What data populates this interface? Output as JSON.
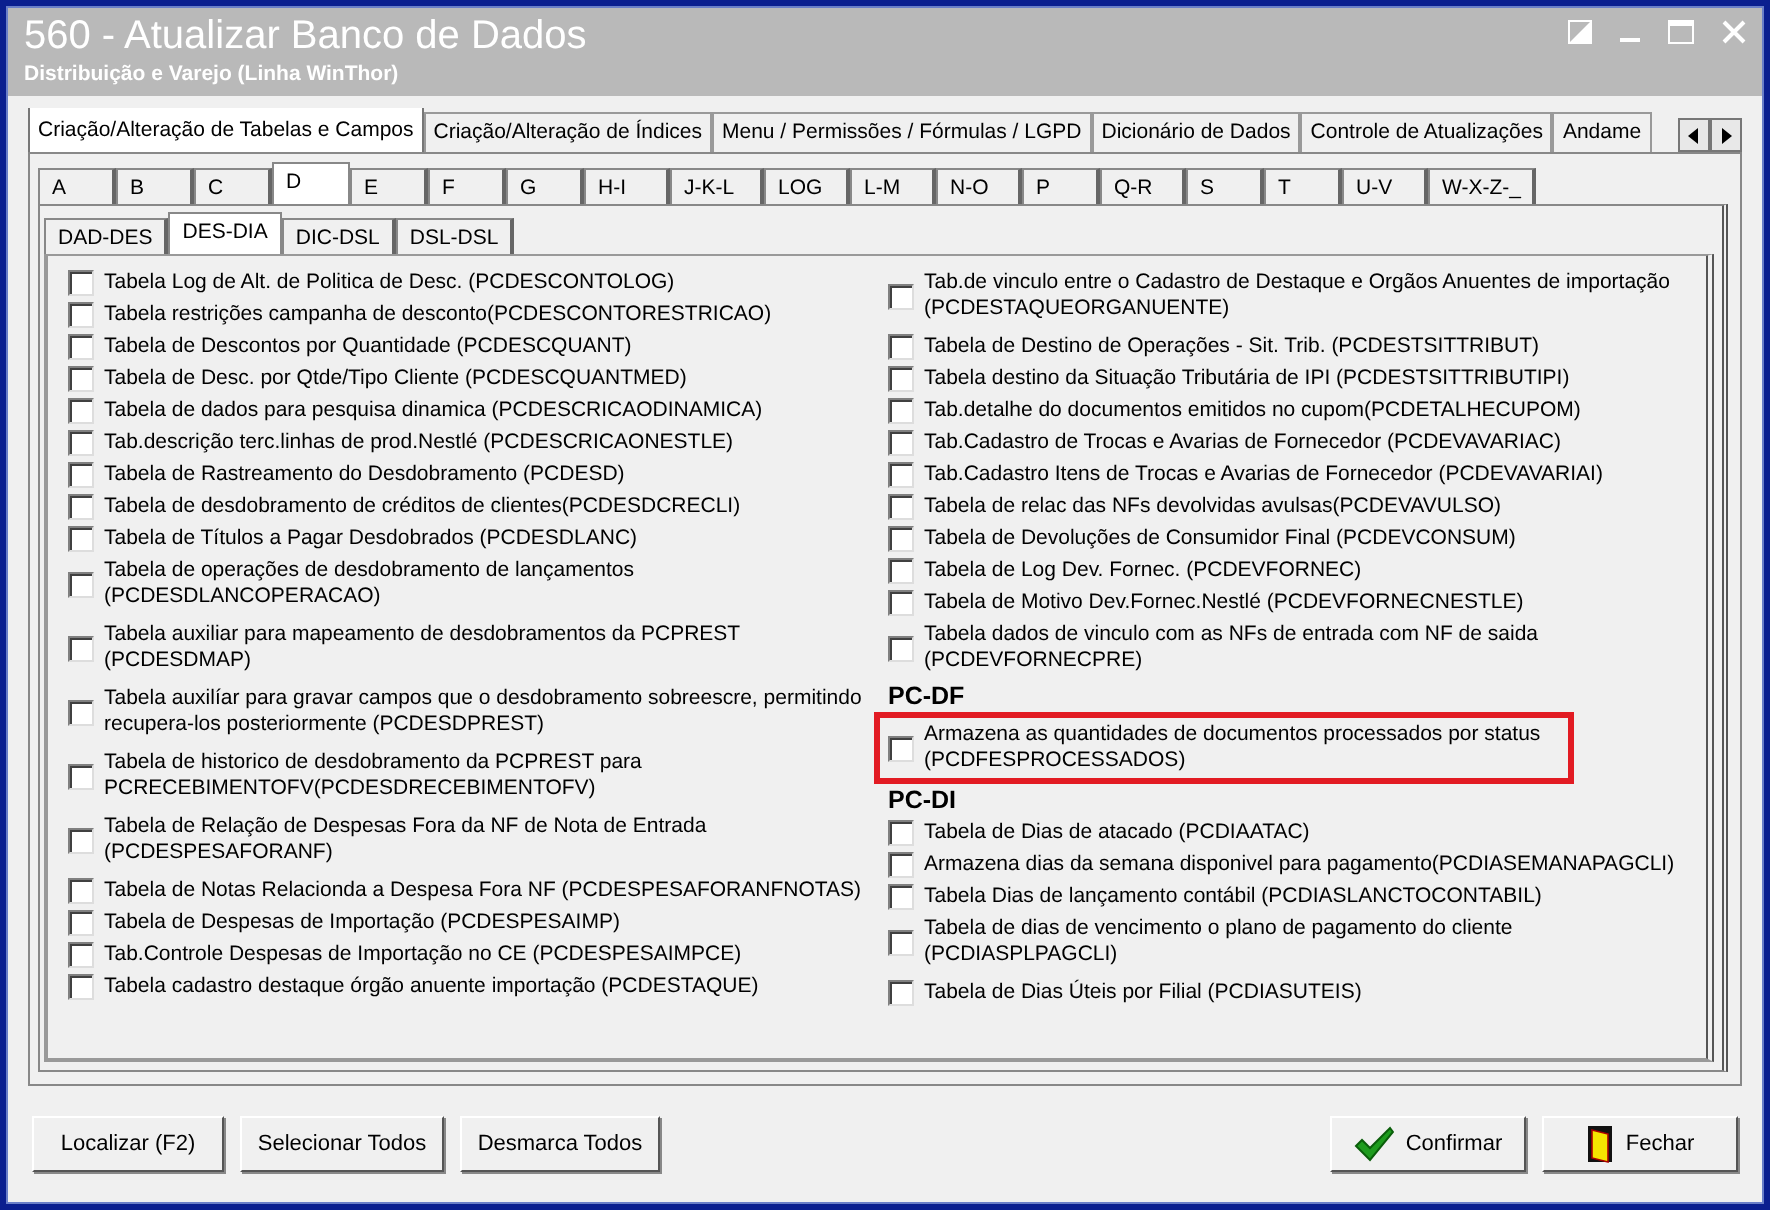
{
  "window": {
    "title": "560 - Atualizar Banco de Dados",
    "subtitle": "Distribuição e Varejo (Linha WinThor)"
  },
  "main_tabs": [
    {
      "label": "Criação/Alteração de Tabelas e Campos",
      "selected": true
    },
    {
      "label": "Criação/Alteração de Índices",
      "selected": false
    },
    {
      "label": "Menu / Permissões / Fórmulas / LGPD",
      "selected": false
    },
    {
      "label": "Dicionário de Dados",
      "selected": false
    },
    {
      "label": "Controle de Atualizações",
      "selected": false
    },
    {
      "label": "Andame",
      "selected": false
    }
  ],
  "letter_tabs": [
    {
      "label": "A",
      "selected": false
    },
    {
      "label": "B",
      "selected": false
    },
    {
      "label": "C",
      "selected": false
    },
    {
      "label": "D",
      "selected": true
    },
    {
      "label": "E",
      "selected": false
    },
    {
      "label": "F",
      "selected": false
    },
    {
      "label": "G",
      "selected": false
    },
    {
      "label": "H-I",
      "selected": false
    },
    {
      "label": "J-K-L",
      "selected": false
    },
    {
      "label": "LOG",
      "selected": false
    },
    {
      "label": "L-M",
      "selected": false
    },
    {
      "label": "N-O",
      "selected": false
    },
    {
      "label": "P",
      "selected": false
    },
    {
      "label": "Q-R",
      "selected": false
    },
    {
      "label": "S",
      "selected": false
    },
    {
      "label": "T",
      "selected": false
    },
    {
      "label": "U-V",
      "selected": false
    },
    {
      "label": "W-X-Z-_",
      "selected": false
    }
  ],
  "sub_tabs": [
    {
      "label": "DAD-DES",
      "selected": false
    },
    {
      "label": "DES-DIA",
      "selected": true
    },
    {
      "label": "DIC-DSL",
      "selected": false
    },
    {
      "label": "DSL-DSL",
      "selected": false
    }
  ],
  "left_items": [
    {
      "kind": "checkbox",
      "label": "Tabela Log de Alt. de Politica de Desc. (PCDESCONTOLOG)",
      "checked": false
    },
    {
      "kind": "checkbox",
      "label": "Tabela restrições campanha de desconto(PCDESCONTORESTRICAO)",
      "checked": false
    },
    {
      "kind": "checkbox",
      "label": "Tabela de Descontos por Quantidade (PCDESCQUANT)",
      "checked": false
    },
    {
      "kind": "checkbox",
      "label": "Tabela de Desc. por Qtde/Tipo Cliente (PCDESCQUANTMED)",
      "checked": false
    },
    {
      "kind": "checkbox",
      "label": "Tabela de dados para pesquisa dinamica (PCDESCRICAODINAMICA)",
      "checked": false
    },
    {
      "kind": "checkbox",
      "label": "Tab.descrição terc.linhas de prod.Nestlé (PCDESCRICAONESTLE)",
      "checked": false
    },
    {
      "kind": "checkbox",
      "label": "Tabela de Rastreamento do Desdobramento (PCDESD)",
      "checked": false
    },
    {
      "kind": "checkbox",
      "label": "Tabela de desdobramento de créditos de clientes(PCDESDCRECLI)",
      "checked": false
    },
    {
      "kind": "checkbox",
      "label": "Tabela de Títulos a Pagar Desdobrados (PCDESDLANC)",
      "checked": false
    },
    {
      "kind": "checkbox",
      "label": "Tabela de operações de desdobramento de lançamentos\n(PCDESDLANCOPERACAO)",
      "checked": false
    },
    {
      "kind": "checkbox",
      "label": "Tabela auxiliar para mapeamento de desdobramentos da PCPREST\n(PCDESDMAP)",
      "checked": false
    },
    {
      "kind": "checkbox",
      "label": "Tabela auxilíar para gravar campos que o desdobramento sobreescre, permitindo\nrecupera-los posteriormente (PCDESDPREST)",
      "checked": false
    },
    {
      "kind": "checkbox",
      "label": "Tabela de historico de desdobramento da PCPREST para\nPCRECEBIMENTOFV(PCDESDRECEBIMENTOFV)",
      "checked": false
    },
    {
      "kind": "checkbox",
      "label": "Tabela de Relação de Despesas Fora da NF de Nota de Entrada\n(PCDESPESAFORANF)",
      "checked": false
    },
    {
      "kind": "checkbox",
      "label": "Tabela de Notas Relacionda a Despesa Fora NF (PCDESPESAFORANFNOTAS)",
      "checked": false
    },
    {
      "kind": "checkbox",
      "label": "Tabela de Despesas de Importação (PCDESPESAIMP)",
      "checked": false
    },
    {
      "kind": "checkbox",
      "label": "Tab.Controle Despesas de Importação no CE (PCDESPESAIMPCE)",
      "checked": false
    },
    {
      "kind": "checkbox",
      "label": "Tabela cadastro destaque órgão anuente importação (PCDESTAQUE)",
      "checked": false
    }
  ],
  "right_items": [
    {
      "kind": "checkbox",
      "label": "Tab.de vinculo entre o Cadastro de Destaque e Orgãos Anuentes de importação\n(PCDESTAQUEORGANUENTE)",
      "checked": false
    },
    {
      "kind": "checkbox",
      "label": "Tabela de Destino de Operações - Sit. Trib. (PCDESTSITTRIBUT)",
      "checked": false
    },
    {
      "kind": "checkbox",
      "label": "Tabela destino da Situação Tributária de IPI (PCDESTSITTRIBUTIPI)",
      "checked": false
    },
    {
      "kind": "checkbox",
      "label": "Tab.detalhe do documentos emitidos no cupom(PCDETALHECUPOM)",
      "checked": false
    },
    {
      "kind": "checkbox",
      "label": "Tab.Cadastro de Trocas e Avarias de Fornecedor (PCDEVAVARIAC)",
      "checked": false
    },
    {
      "kind": "checkbox",
      "label": "Tab.Cadastro Itens de Trocas e Avarias de Fornecedor (PCDEVAVARIAI)",
      "checked": false
    },
    {
      "kind": "checkbox",
      "label": "Tabela de relac das NFs devolvidas avulsas(PCDEVAVULSO)",
      "checked": false
    },
    {
      "kind": "checkbox",
      "label": "Tabela de Devoluções de Consumidor Final (PCDEVCONSUM)",
      "checked": false
    },
    {
      "kind": "checkbox",
      "label": "Tabela de Log Dev. Fornec. (PCDEVFORNEC)",
      "checked": false
    },
    {
      "kind": "checkbox",
      "label": "Tabela de Motivo Dev.Fornec.Nestlé (PCDEVFORNECNESTLE)",
      "checked": false
    },
    {
      "kind": "checkbox",
      "label": "Tabela dados de vinculo com as NFs de entrada com NF de saida\n(PCDEVFORNECPRE)",
      "checked": false
    },
    {
      "kind": "header",
      "label": "PC-DF"
    },
    {
      "kind": "checkbox",
      "label": "Armazena as quantidades de documentos processados por status\n(PCDFESPROCESSADOS)",
      "checked": false,
      "highlighted": true
    },
    {
      "kind": "header",
      "label": "PC-DI"
    },
    {
      "kind": "checkbox",
      "label": "Tabela de Dias de atacado (PCDIAATAC)",
      "checked": false
    },
    {
      "kind": "checkbox",
      "label": "Armazena dias da semana disponivel para pagamento(PCDIASEMANAPAGCLI)",
      "checked": false
    },
    {
      "kind": "checkbox",
      "label": "Tabela Dias de lançamento contábil (PCDIASLANCTOCONTABIL)",
      "checked": false
    },
    {
      "kind": "checkbox",
      "label": "Tabela de dias de vencimento o plano de pagamento do cliente\n(PCDIASPLPAGCLI)",
      "checked": false
    },
    {
      "kind": "checkbox",
      "label": "Tabela de Dias Úteis por Filial (PCDIASUTEIS)",
      "checked": false
    }
  ],
  "buttons_left": [
    {
      "label": "Localizar (F2)"
    },
    {
      "label": "Selecionar Todos"
    },
    {
      "label": "Desmarca Todos"
    }
  ],
  "buttons_right": [
    {
      "kind": "confirm",
      "label": "Confirmar"
    },
    {
      "kind": "close",
      "label": "Fechar"
    }
  ]
}
